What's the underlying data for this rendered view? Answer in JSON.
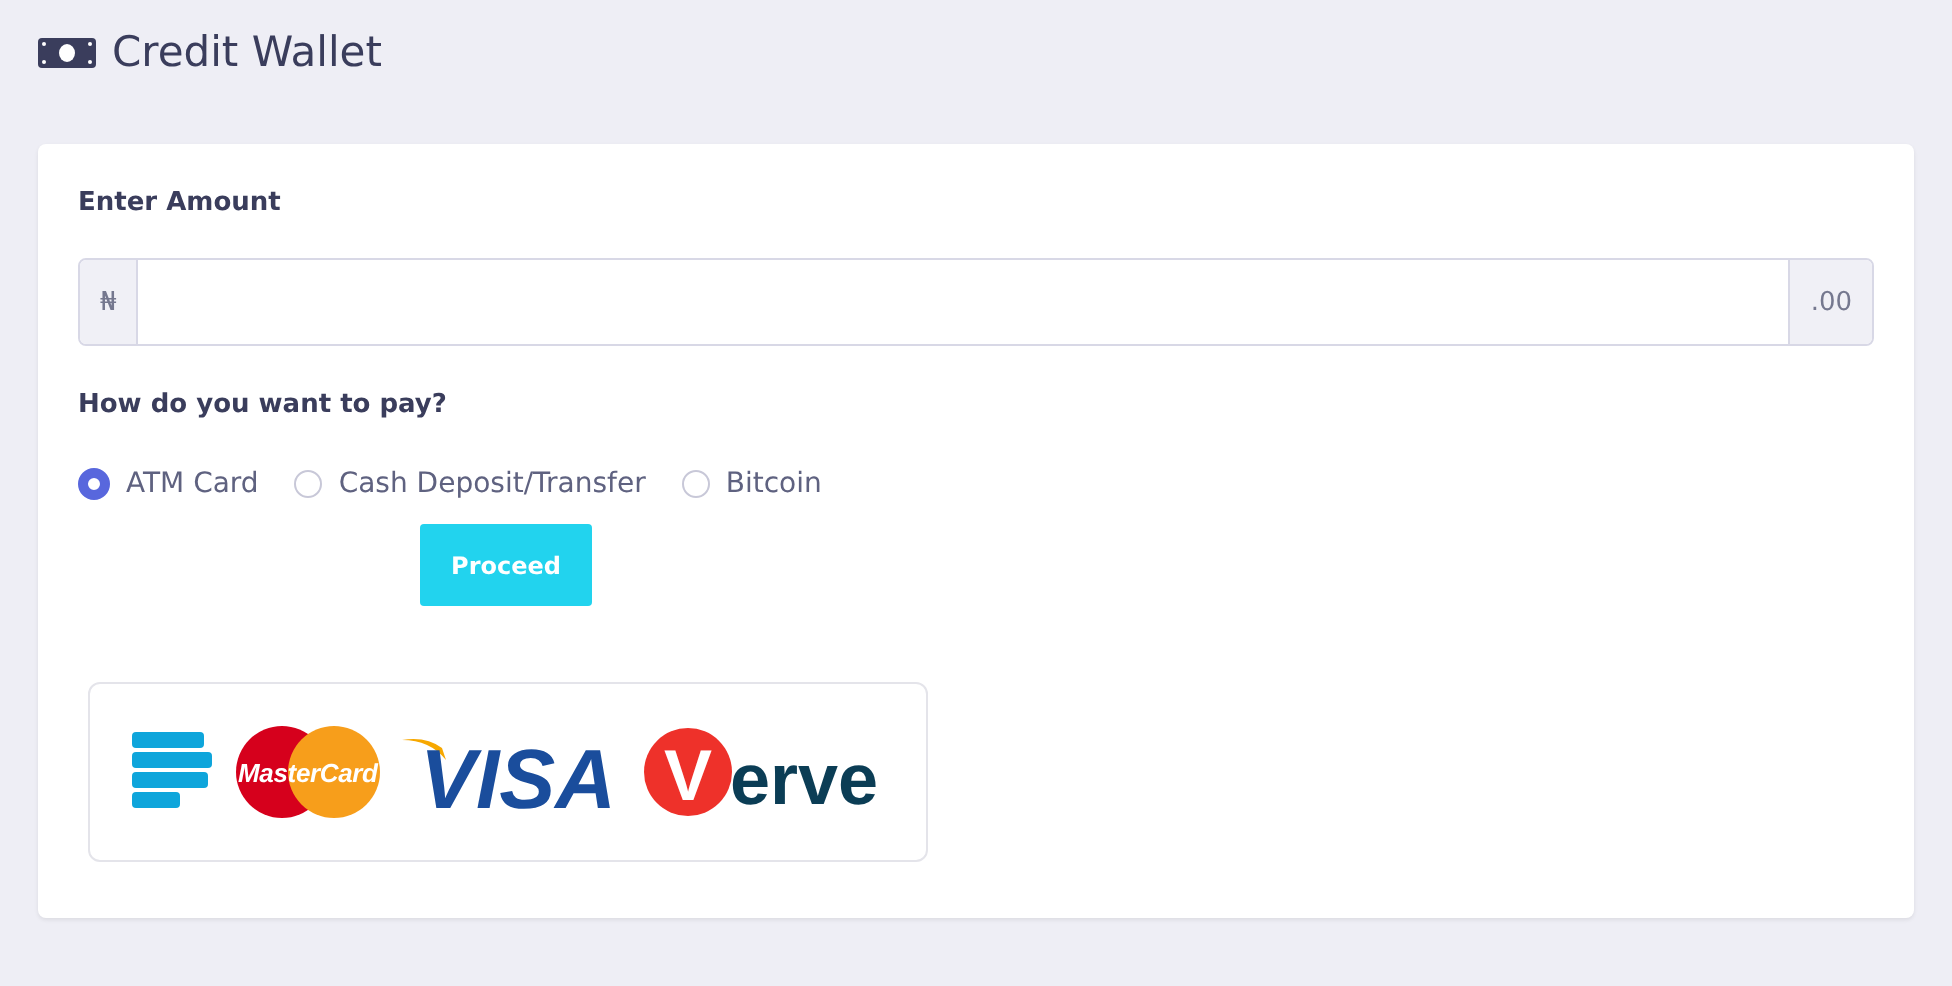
{
  "page": {
    "title": "Credit Wallet"
  },
  "amount": {
    "label": "Enter Amount",
    "prefix": "₦",
    "suffix": ".00"
  },
  "payment": {
    "question": "How do you want to pay?",
    "options": [
      {
        "label": "ATM Card",
        "selected": true
      },
      {
        "label": "Cash Deposit/Transfer",
        "selected": false
      },
      {
        "label": "Bitcoin",
        "selected": false
      }
    ],
    "button": "Proceed"
  },
  "logos": [
    {
      "kind": "stripes"
    },
    {
      "kind": "mastercard",
      "text": "MasterCard"
    },
    {
      "kind": "visa",
      "text": "VISA"
    },
    {
      "kind": "verve",
      "initial": "V",
      "text": "erve"
    }
  ]
}
